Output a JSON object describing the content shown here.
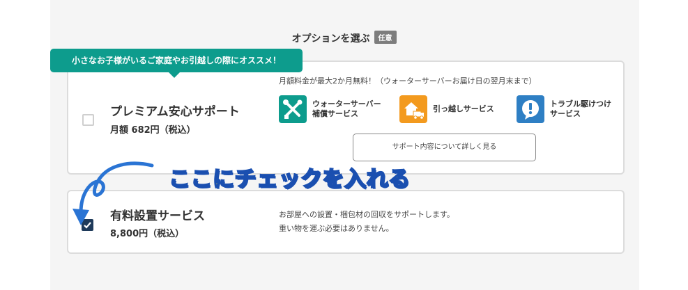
{
  "section": {
    "title": "オプションを選ぶ",
    "badge": "任意"
  },
  "promo_banner": "小さなお子様がいるご家庭やお引越しの際にオススメ！",
  "premium": {
    "name": "プレミアム安心サポート",
    "price": "月額 682円（税込）",
    "checked": false,
    "note": "月額料金が最大2か月無料！（ウォーターサーバーお届け日の翌月末まで）",
    "services": [
      {
        "label": "ウォーターサーバー\n補償サービス",
        "icon": "wrench-screwdriver-icon",
        "color": "#0d9c8d"
      },
      {
        "label": "引っ越しサービス",
        "icon": "moving-truck-icon",
        "color": "#f39a1e"
      },
      {
        "label": "トラブル駆けつけ\nサービス",
        "icon": "alert-bubble-icon",
        "color": "#2e7fc4"
      }
    ],
    "detail_button": "サポート内容について詳しく見る"
  },
  "installation": {
    "name": "有料設置サービス",
    "price": "8,800円（税込）",
    "checked": true,
    "desc_line1": "お部屋への設置・梱包材の回収をサポートします。",
    "desc_line2": "重い物を運ぶ必要はありません。"
  },
  "annotation": "ここにチェックを入れる",
  "colors": {
    "teal": "#0d9c8d",
    "orange": "#f39a1e",
    "blue": "#2e7fc4",
    "navy_check": "#1e3a5a",
    "annotation_fill": "#ffeb1c",
    "annotation_stroke": "#1a4fb0"
  }
}
